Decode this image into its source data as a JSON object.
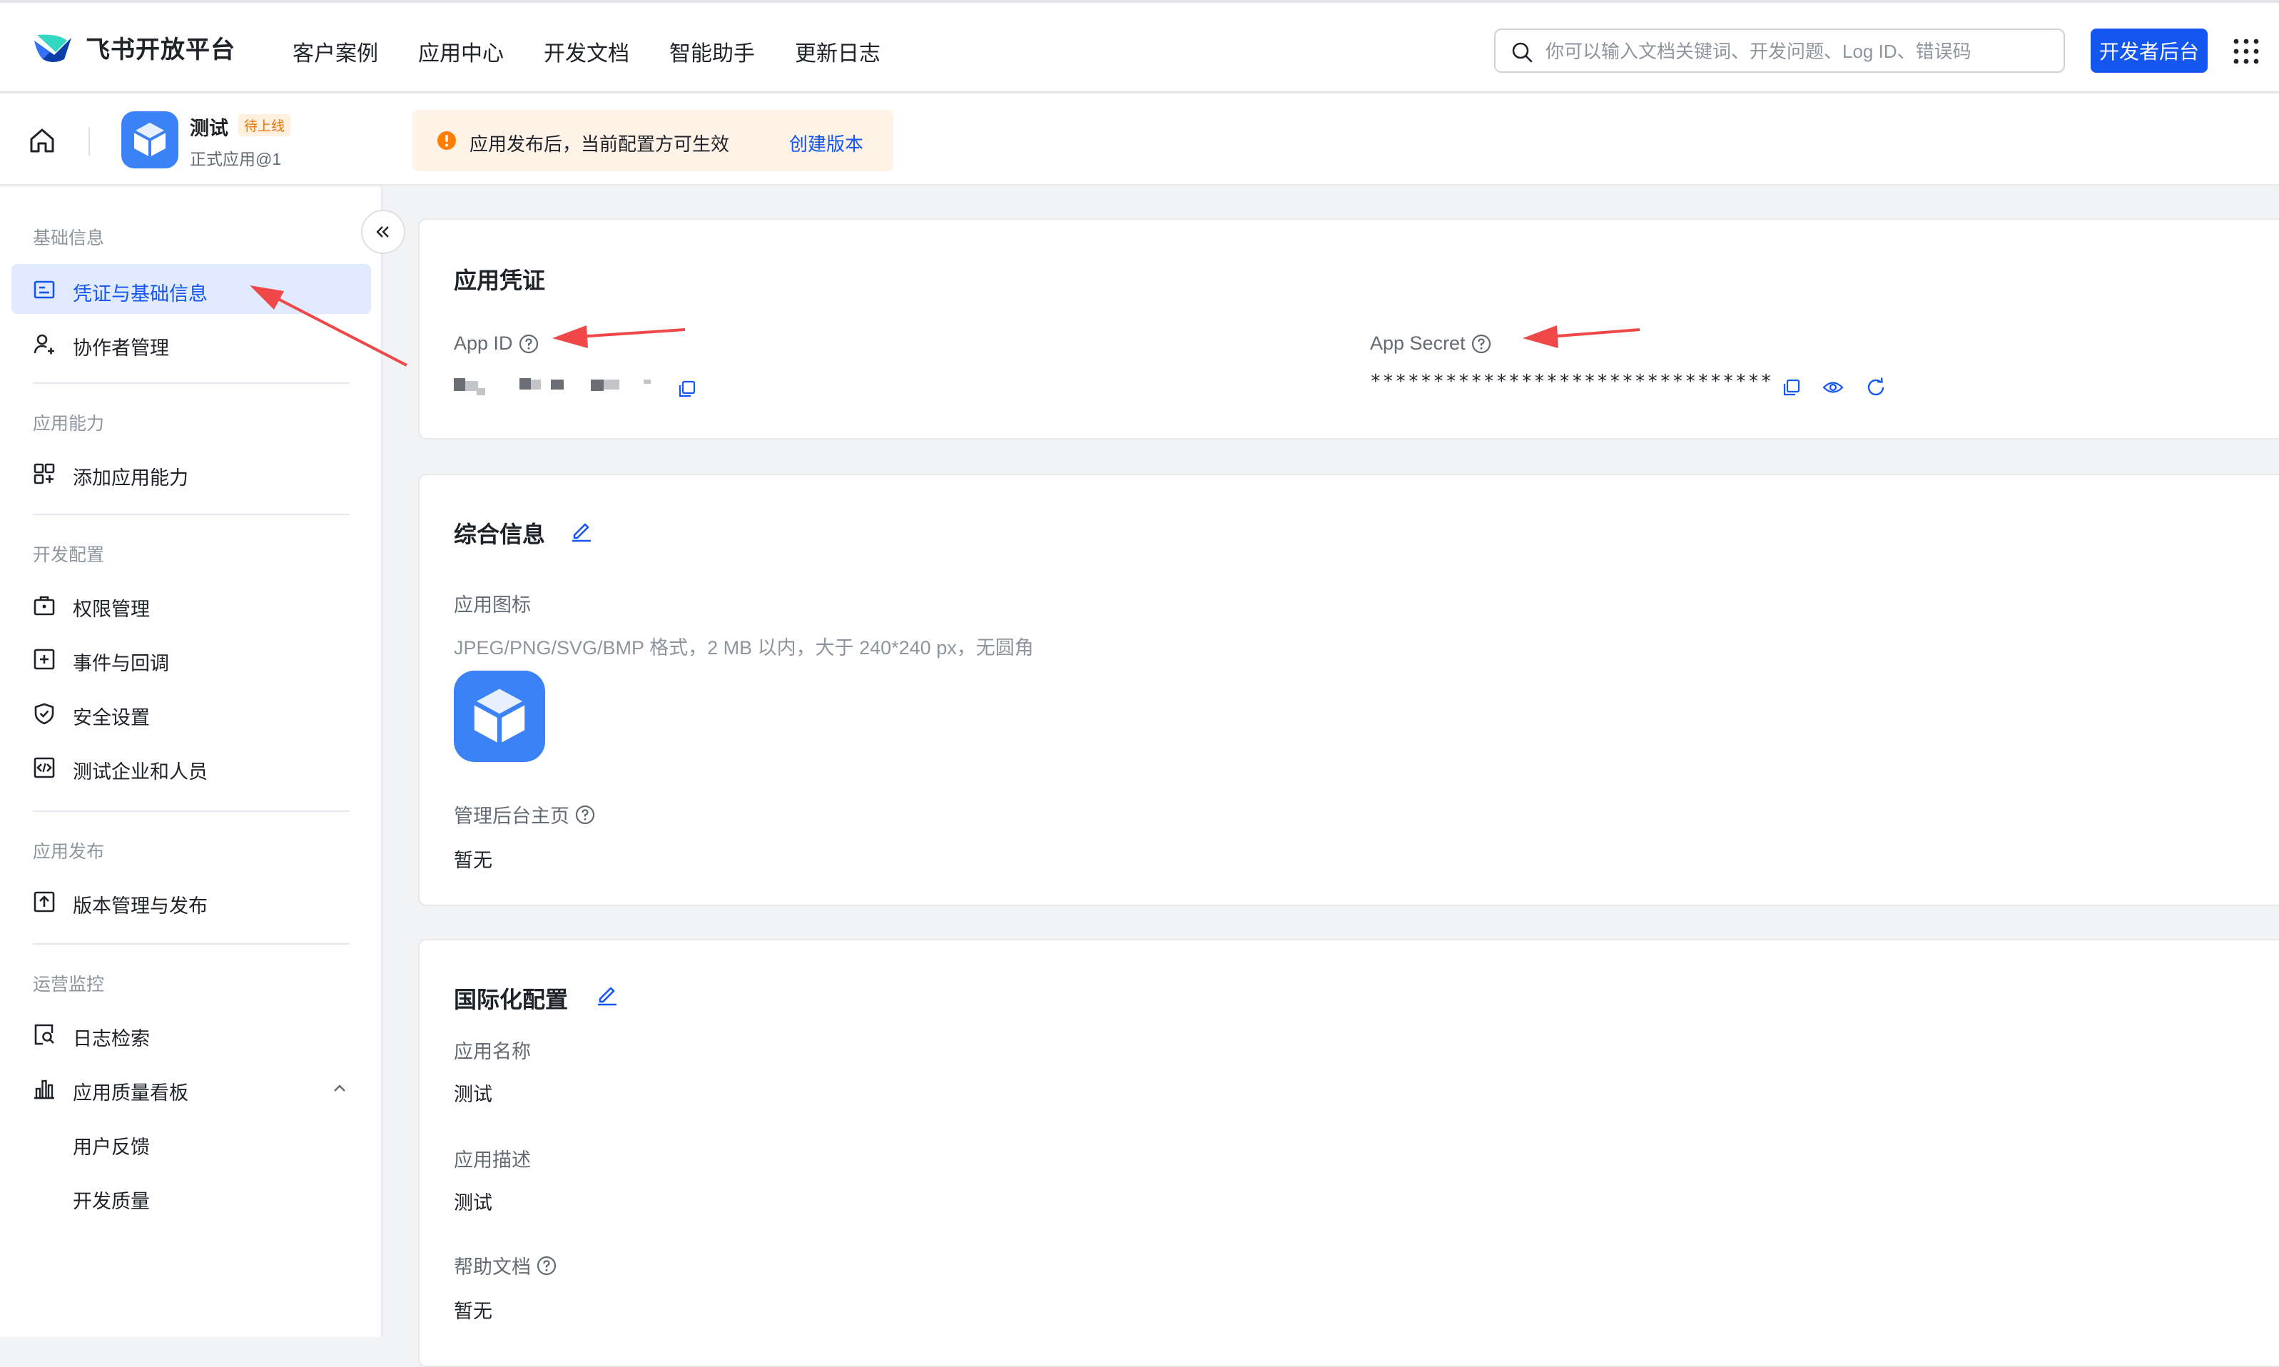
{
  "topnav": {
    "brand": "飞书开放平台",
    "items": [
      "客户案例",
      "应用中心",
      "开发文档",
      "智能助手",
      "更新日志"
    ],
    "search_placeholder": "你可以输入文档关键词、开发问题、Log ID、错误码",
    "dev_console_label": "开发者后台"
  },
  "app_header": {
    "app_name": "测试",
    "status": "待上线",
    "subtitle": "正式应用@1",
    "notice_text": "应用发布后，当前配置方可生效",
    "notice_link": "创建版本"
  },
  "sidebar": {
    "sections": [
      {
        "title": "基础信息",
        "items": [
          {
            "label": "凭证与基础信息",
            "icon": "credential-icon",
            "active": true
          },
          {
            "label": "协作者管理",
            "icon": "user-add-icon"
          }
        ]
      },
      {
        "title": "应用能力",
        "items": [
          {
            "label": "添加应用能力",
            "icon": "apps-add-icon"
          }
        ]
      },
      {
        "title": "开发配置",
        "items": [
          {
            "label": "权限管理",
            "icon": "lock-box-icon"
          },
          {
            "label": "事件与回调",
            "icon": "event-icon"
          },
          {
            "label": "安全设置",
            "icon": "shield-icon"
          },
          {
            "label": "测试企业和人员",
            "icon": "code-icon"
          }
        ]
      },
      {
        "title": "应用发布",
        "items": [
          {
            "label": "版本管理与发布",
            "icon": "upload-icon"
          }
        ]
      },
      {
        "title": "运营监控",
        "items": [
          {
            "label": "日志检索",
            "icon": "log-search-icon"
          },
          {
            "label": "应用质量看板",
            "icon": "bar-chart-icon",
            "sub": [
              "用户反馈",
              "开发质量"
            ]
          }
        ]
      }
    ]
  },
  "credentials": {
    "title": "应用凭证",
    "app_id_label": "App ID",
    "app_secret_label": "App Secret",
    "app_secret_masked": "********************************"
  },
  "general_info": {
    "title": "综合信息",
    "icon_label": "应用图标",
    "icon_hint": "JPEG/PNG/SVG/BMP 格式，2 MB 以内，大于 240*240 px，无圆角",
    "admin_home_label": "管理后台主页",
    "admin_home_value": "暂无"
  },
  "i18n": {
    "title": "国际化配置",
    "name_label": "应用名称",
    "name_value": "测试",
    "desc_label": "应用描述",
    "desc_value": "测试",
    "help_label": "帮助文档",
    "help_value": "暂无"
  },
  "colors": {
    "primary": "#1456f0",
    "active_bg": "#e1eaff",
    "warning": "#ff7d00",
    "annotation_arrow": "#f04848"
  }
}
